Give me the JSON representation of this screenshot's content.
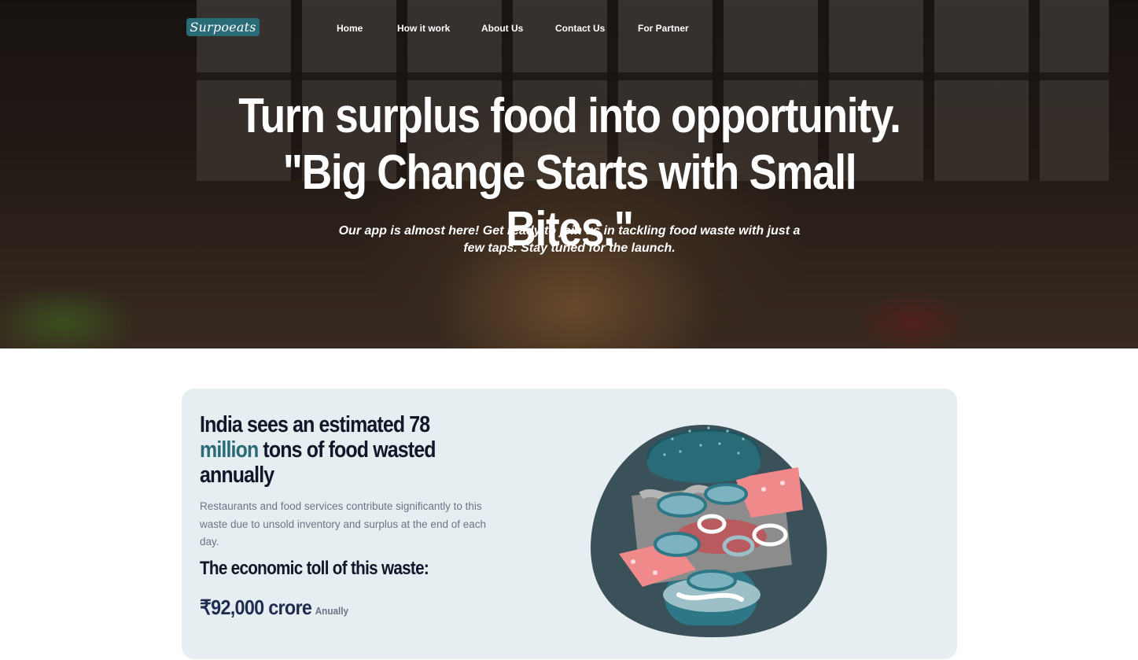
{
  "nav": {
    "logo": "Surpoeats",
    "links": [
      "Home",
      "How it work",
      "About Us",
      "Contact Us",
      "For Partner"
    ]
  },
  "hero": {
    "title": "Turn surplus food into opportunity. \"Big Change Starts with Small Bites.\"",
    "subtitle": "Our app is almost here! Get ready to join us in tackling food waste with just a few taps. Stay tuned for the launch."
  },
  "stats": {
    "title_pre": "India sees an estimated  78 ",
    "title_accent": "million",
    "title_post": " tons of food wasted annually",
    "description": "Restaurants and food services contribute significantly to this waste due to unsold inventory and surplus at the end of each day.",
    "toll_heading": "The economic toll of this waste:",
    "toll_amount": "₹92,000 crore",
    "toll_period": "Anually"
  },
  "colors": {
    "brand": "#2a6b78",
    "heading": "#121629",
    "card_bg": "#e7eef1",
    "burger_pink": "#f08a8a"
  },
  "icons": {
    "illustration": "exploded-burger-illustration"
  }
}
